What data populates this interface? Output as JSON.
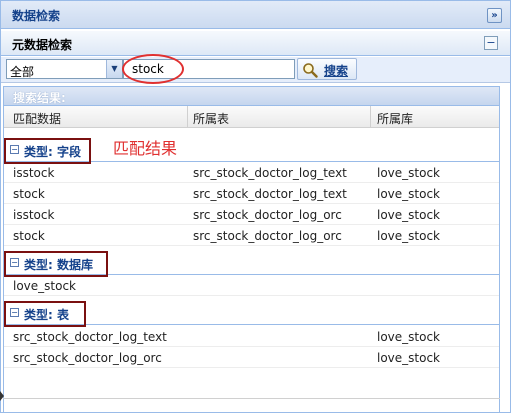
{
  "panel": {
    "title": "数据检索",
    "collapse_icon": "»"
  },
  "section": {
    "title": "元数据检索",
    "toggle_icon": "−"
  },
  "search": {
    "scope": "全部",
    "query": "stock",
    "button_label": "搜索"
  },
  "results": {
    "title": "搜索结果:",
    "columns": [
      "匹配数据",
      "所属表",
      "所属库"
    ],
    "annotation": "匹配结果",
    "groups": [
      {
        "label": "类型: 字段",
        "rows": [
          [
            "isstock",
            "src_stock_doctor_log_text",
            "love_stock"
          ],
          [
            "stock",
            "src_stock_doctor_log_text",
            "love_stock"
          ],
          [
            "isstock",
            "src_stock_doctor_log_orc",
            "love_stock"
          ],
          [
            "stock",
            "src_stock_doctor_log_orc",
            "love_stock"
          ]
        ]
      },
      {
        "label": "类型: 数据库",
        "rows": [
          [
            "love_stock",
            "",
            ""
          ]
        ]
      },
      {
        "label": "类型: 表",
        "rows": [
          [
            "src_stock_doctor_log_text",
            "",
            "love_stock"
          ],
          [
            "src_stock_doctor_log_orc",
            "",
            "love_stock"
          ]
        ]
      }
    ]
  },
  "colors": {
    "header_text": "#15428b",
    "highlight": "#e03030",
    "group_box": "#7a1010"
  }
}
